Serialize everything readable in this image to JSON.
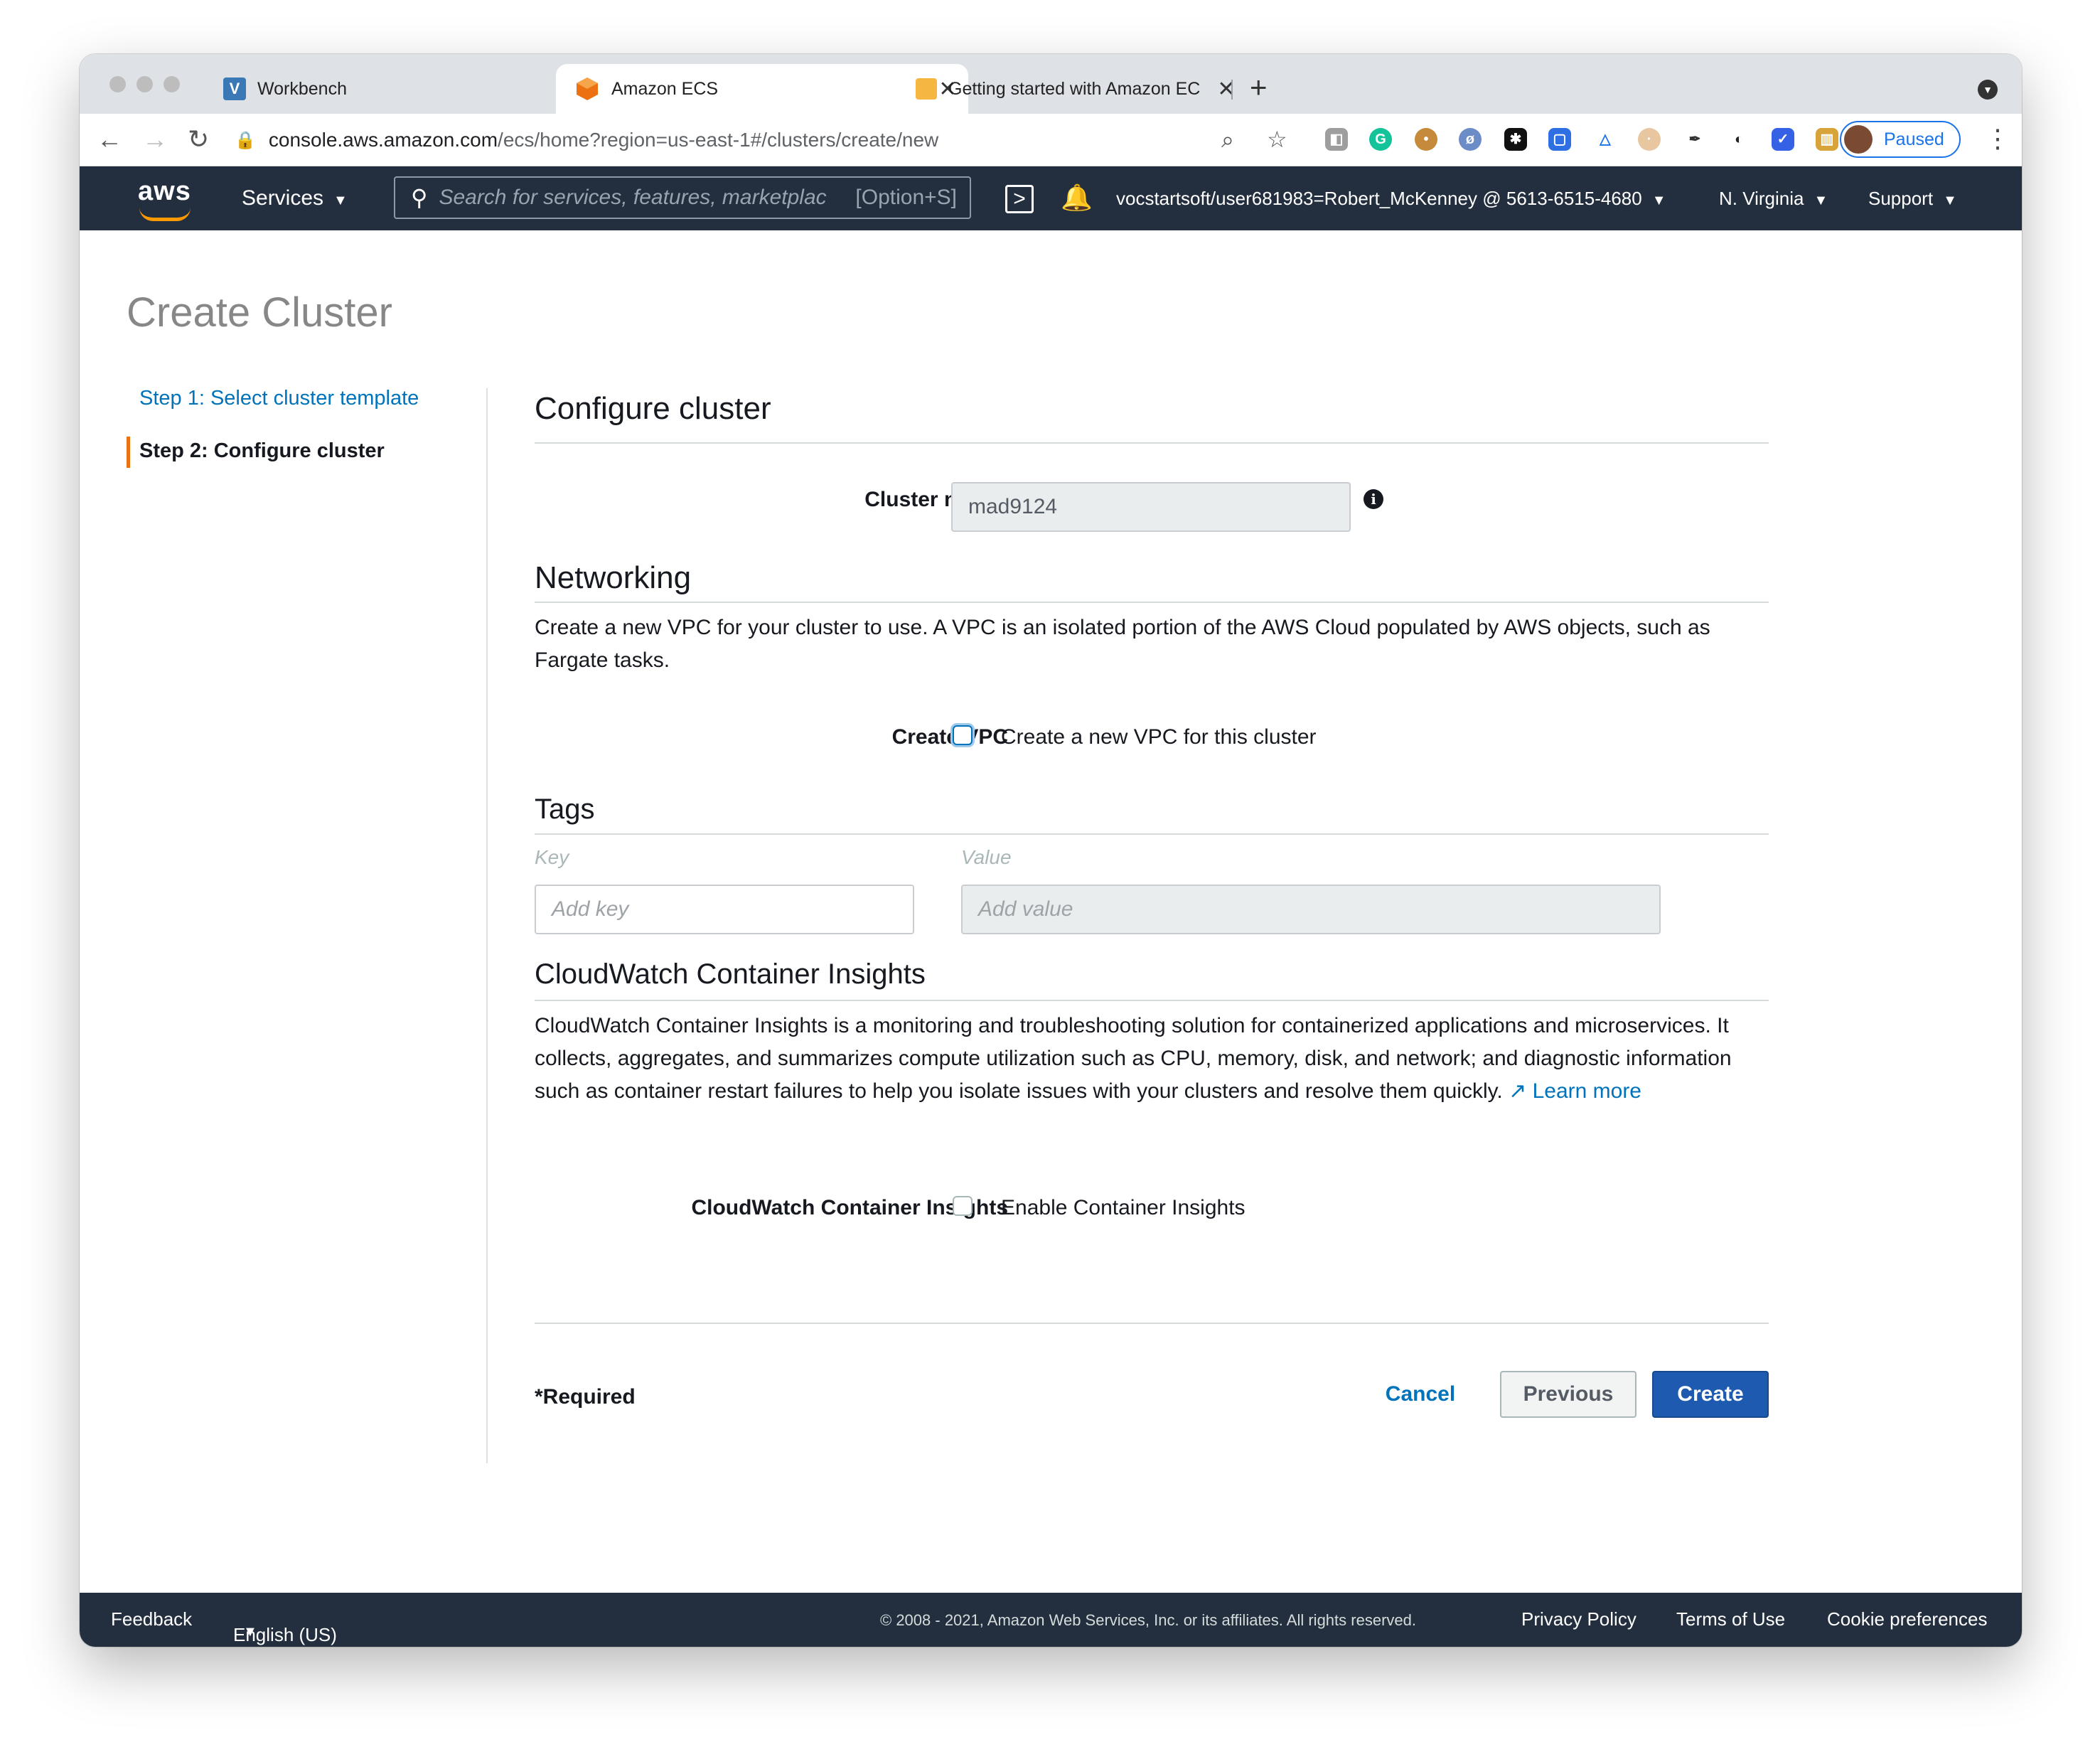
{
  "browser": {
    "tabs": [
      {
        "label": "Workbench",
        "icon": "workbench-favicon"
      },
      {
        "label": "Amazon ECS",
        "icon": "ecs-favicon"
      },
      {
        "label": "Getting started with Amazon EC",
        "icon": "docs-favicon"
      }
    ],
    "url_host": "console.aws.amazon.com",
    "url_path": "/ecs/home?region=us-east-1#/clusters/create/new",
    "profile_status": "Paused"
  },
  "aws_nav": {
    "logo_text": "aws",
    "services_label": "Services",
    "search_placeholder": "Search for services, features, marketplac",
    "search_shortcut": "[Option+S]",
    "account": "vocstartsoft/user681983=Robert_McKenney @ 5613-6515-4680",
    "region": "N. Virginia",
    "support": "Support"
  },
  "page": {
    "title": "Create Cluster",
    "steps": [
      {
        "label": "Step 1: Select cluster template",
        "active": false
      },
      {
        "label": "Step 2: Configure cluster",
        "active": true
      }
    ]
  },
  "form": {
    "heading": "Configure cluster",
    "cluster_name_label": "Cluster name*",
    "cluster_name_value": "mad9124",
    "networking": {
      "heading": "Networking",
      "description": "Create a new VPC for your cluster to use. A VPC is an isolated portion of the AWS Cloud populated by AWS objects, such as Fargate tasks.",
      "create_vpc_label": "Create VPC",
      "create_vpc_checkbox_label": "Create a new VPC for this cluster",
      "create_vpc_checked": false
    },
    "tags": {
      "heading": "Tags",
      "key_header": "Key",
      "value_header": "Value",
      "key_placeholder": "Add key",
      "value_placeholder": "Add value"
    },
    "insights": {
      "heading": "CloudWatch Container Insights",
      "description": "CloudWatch Container Insights is a monitoring and troubleshooting solution for containerized applications and microservices. It collects, aggregates, and summarizes compute utilization such as CPU, memory, disk, and network; and diagnostic information such as container restart failures to help you isolate issues with your clusters and resolve them quickly.",
      "learn_more": "Learn more",
      "label": "CloudWatch Container Insights",
      "checkbox_label": "Enable Container Insights",
      "checked": false
    },
    "required_note": "*Required",
    "buttons": {
      "cancel": "Cancel",
      "previous": "Previous",
      "create": "Create"
    }
  },
  "footer": {
    "feedback": "Feedback",
    "language": "English (US)",
    "copyright": "© 2008 - 2021, Amazon Web Services, Inc. or its affiliates. All rights reserved.",
    "privacy": "Privacy Policy",
    "terms": "Terms of Use",
    "cookies": "Cookie preferences"
  },
  "colors": {
    "aws_nav_bg": "#232f3e",
    "link_blue": "#0073bb",
    "primary_button": "#1e5bb0",
    "step_accent": "#ec7211"
  }
}
